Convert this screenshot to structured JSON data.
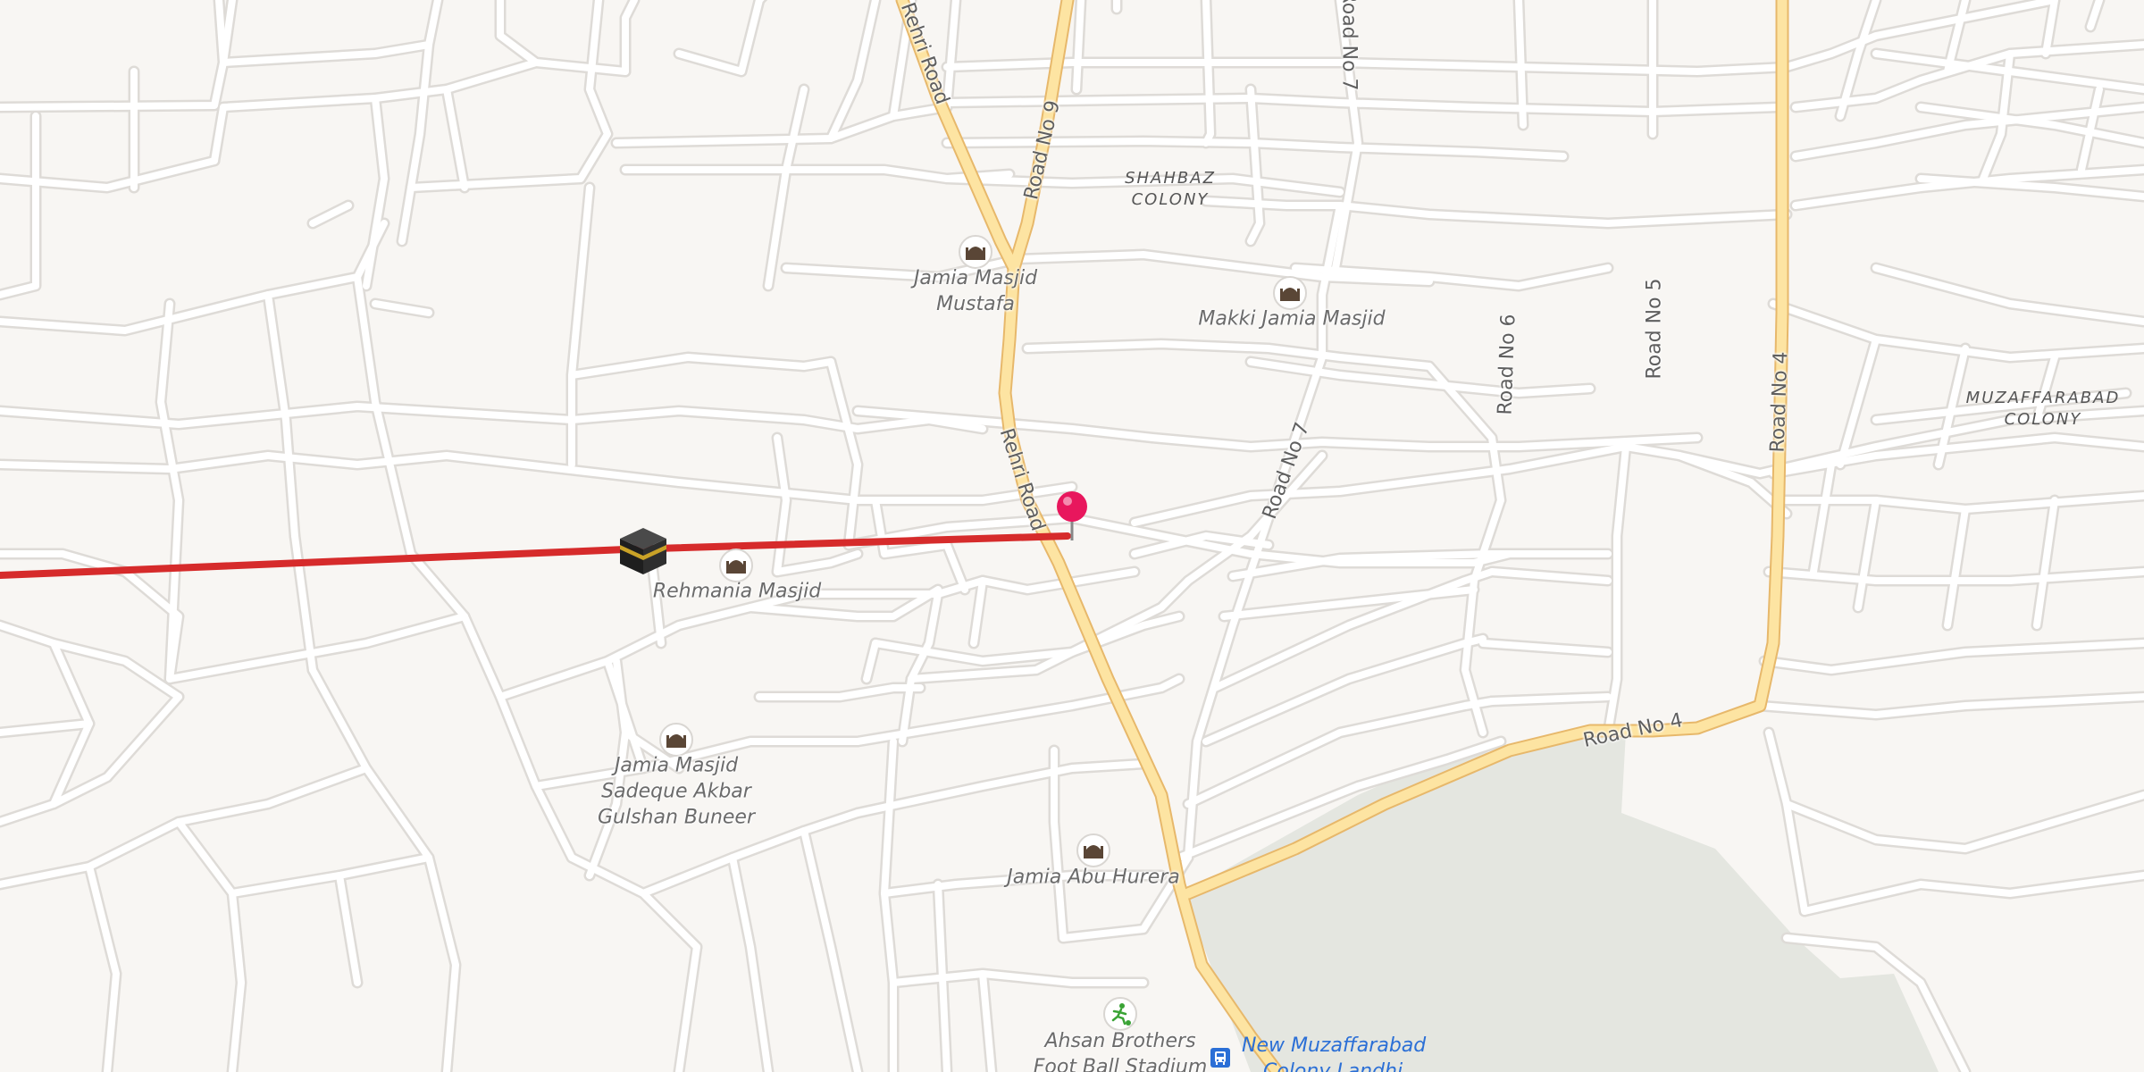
{
  "map": {
    "colors": {
      "background": "#f8f6f3",
      "minor_road": "#ffffff",
      "minor_road_casing": "#dedbd7",
      "major_road": "#fde4a2",
      "major_road_casing": "#e7b86b",
      "park": "#e4e6e0",
      "route_line": "#d62b2b",
      "pin": "#e8175d",
      "bus_stop": "#2b6fd6"
    },
    "area_labels": [
      {
        "line1": "SHAHBAZ",
        "line2": "COLONY"
      },
      {
        "line1": "MUZAFFARABAD",
        "line2": "COLONY"
      }
    ],
    "road_labels": [
      {
        "text": "Rehri Road"
      },
      {
        "text": "Road No 9"
      },
      {
        "text": "Rehri Road"
      },
      {
        "text": "Road No 7"
      },
      {
        "text": "Road No 7"
      },
      {
        "text": "Road No 6"
      },
      {
        "text": "Road No 5"
      },
      {
        "text": "Road No 4"
      },
      {
        "text": "Road No 4"
      }
    ],
    "pois": [
      {
        "name": "Jamia Masjid Mustafa",
        "line1": "Jamia Masjid",
        "line2": "Mustafa",
        "icon": "mosque-icon"
      },
      {
        "name": "Makki Jamia Masjid",
        "line1": "Makki Jamia Masjid",
        "line2": "",
        "icon": "mosque-icon"
      },
      {
        "name": "Rehmania Masjid",
        "line1": "Rehmania Masjid",
        "line2": "",
        "icon": "mosque-icon"
      },
      {
        "name": "Jamia Masjid Sadeque Akbar Gulshan Buneer",
        "line1": "Jamia Masjid",
        "line2": "Sadeque Akbar",
        "line3": "Gulshan Buneer",
        "icon": "mosque-icon"
      },
      {
        "name": "Jamia Abu Hurera",
        "line1": "Jamia Abu Hurera",
        "line2": "",
        "icon": "mosque-icon"
      },
      {
        "name": "Ahsan Brothers Foot Ball Stadium",
        "line1": "Ahsan Brothers",
        "line2": "Foot Ball Stadium",
        "icon": "soccer-icon"
      }
    ],
    "transit": {
      "line1": "New Muzaffarabad",
      "line2": "Colony Landhi",
      "icon": "bus-stop-icon"
    },
    "qibla_icon": "kaaba-icon",
    "pin_icon": "map-pin-icon"
  }
}
